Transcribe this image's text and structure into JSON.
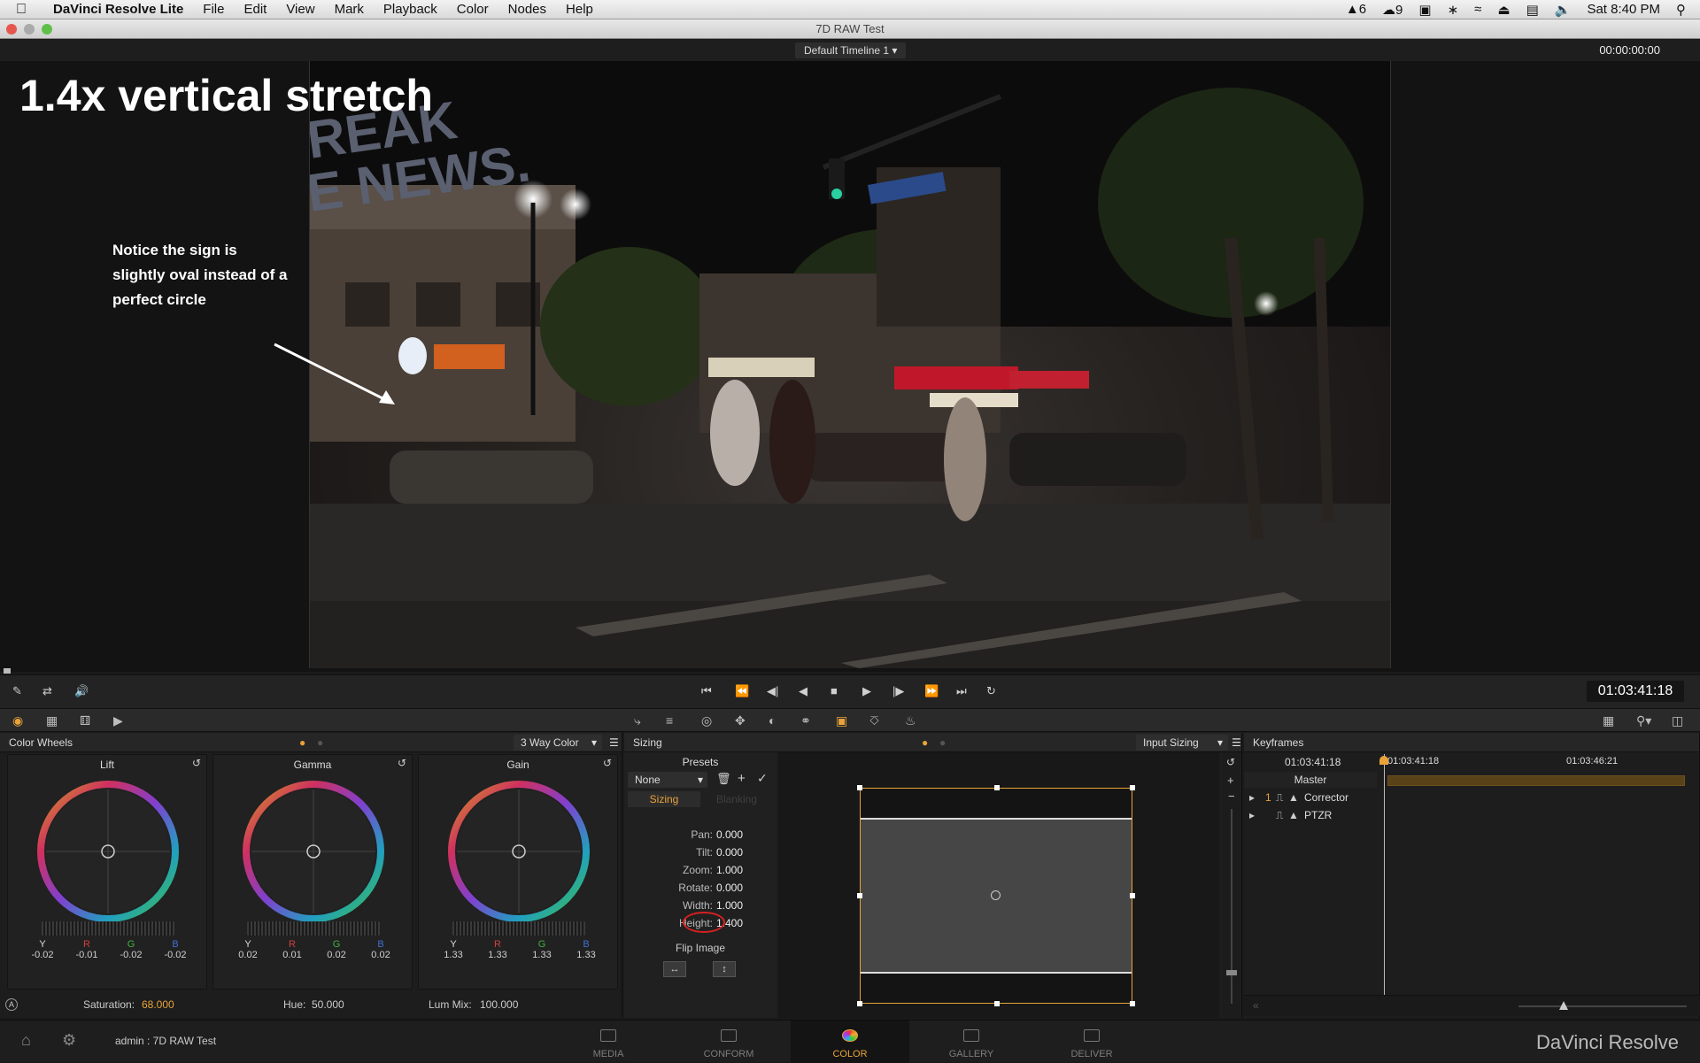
{
  "menubar": {
    "app_name": "DaVinci Resolve Lite",
    "items": [
      "File",
      "Edit",
      "View",
      "Mark",
      "Playback",
      "Color",
      "Nodes",
      "Help"
    ],
    "status_a": "6",
    "status_b": "9",
    "clock": "Sat 8:40 PM"
  },
  "window": {
    "title": "7D RAW Test"
  },
  "viewer": {
    "timeline_dropdown": "Default Timeline 1",
    "header_timecode": "00:00:00:00",
    "overlay_title": "1.4x vertical stretch",
    "overlay_note": "Notice the sign is slightly oval instead of a perfect circle"
  },
  "transport": {
    "current_timecode": "01:03:41:18"
  },
  "color_wheels": {
    "title": "Color Wheels",
    "mode": "3 Way Color",
    "wheels": [
      {
        "name": "Lift",
        "labels": [
          "Y",
          "R",
          "G",
          "B"
        ],
        "values": [
          "-0.02",
          "-0.01",
          "-0.02",
          "-0.02"
        ]
      },
      {
        "name": "Gamma",
        "labels": [
          "Y",
          "R",
          "G",
          "B"
        ],
        "values": [
          "0.02",
          "0.01",
          "0.02",
          "0.02"
        ]
      },
      {
        "name": "Gain",
        "labels": [
          "Y",
          "R",
          "G",
          "B"
        ],
        "values": [
          "1.33",
          "1.33",
          "1.33",
          "1.33"
        ]
      }
    ],
    "saturation_label": "Saturation:",
    "saturation_value": "68.000",
    "hue_label": "Hue:",
    "hue_value": "50.000",
    "lummix_label": "Lum Mix:",
    "lummix_value": "100.000"
  },
  "sizing": {
    "title": "Sizing",
    "mode": "Input Sizing",
    "presets_label": "Presets",
    "preset_value": "None",
    "tab_sizing": "Sizing",
    "tab_blanking": "Blanking",
    "params": [
      {
        "key": "Pan:",
        "value": "0.000"
      },
      {
        "key": "Tilt:",
        "value": "0.000"
      },
      {
        "key": "Zoom:",
        "value": "1.000"
      },
      {
        "key": "Rotate:",
        "value": "0.000"
      },
      {
        "key": "Width:",
        "value": "1.000"
      },
      {
        "key": "Height:",
        "value": "1.400"
      }
    ],
    "flip_label": "Flip Image"
  },
  "keyframes": {
    "title": "Keyframes",
    "tc_current": "01:03:41:18",
    "tc_ruler_a": "01:03:41:18",
    "tc_ruler_b": "01:03:46:21",
    "master_label": "Master",
    "tracks": [
      {
        "index": "1",
        "name": "Corrector"
      },
      {
        "index": "",
        "name": "PTZR"
      }
    ]
  },
  "status": {
    "user_project": "admin : 7D RAW Test",
    "brand": "DaVinci Resolve"
  },
  "pages": [
    "MEDIA",
    "CONFORM",
    "COLOR",
    "GALLERY",
    "DELIVER"
  ],
  "colors": {
    "accent": "#e8a33a",
    "highlight_circle": "#d62020"
  }
}
